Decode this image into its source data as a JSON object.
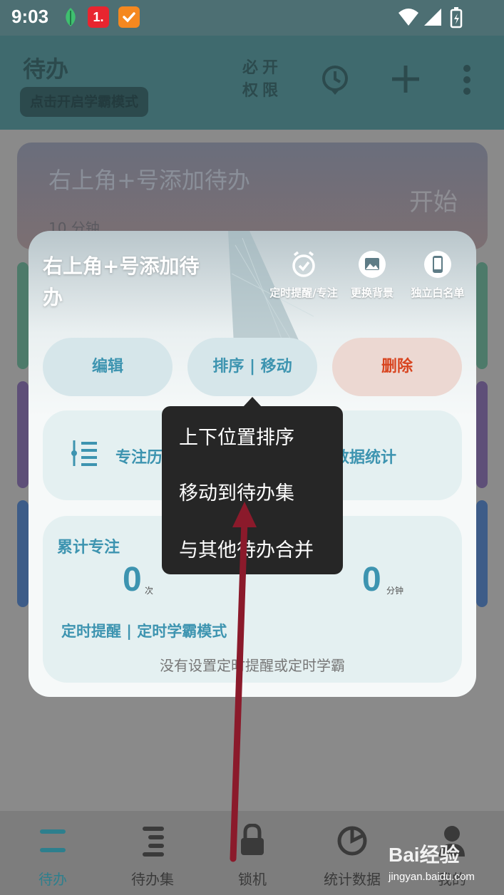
{
  "status_bar": {
    "time": "9:03",
    "app_badge": "1."
  },
  "header": {
    "title": "待办",
    "study_mode": "点击开启学霸模式",
    "permission": "必开权限"
  },
  "background_card": {
    "title": "右上角+号添加待办",
    "start": "开始",
    "duration": "10 分钟"
  },
  "popup": {
    "title": "右上角+号添加待办",
    "top_actions": [
      {
        "label": "定时提醒/专注",
        "icon": "alarm-clock-icon"
      },
      {
        "label": "更换背景",
        "icon": "image-icon"
      },
      {
        "label": "独立白名单",
        "icon": "phone-icon"
      }
    ],
    "buttons": {
      "edit": "编辑",
      "sort_move": "排序 | 移动",
      "delete": "删除"
    },
    "focus_history": "专注历",
    "data_stats": "数据统计",
    "accumulated": "累计专注",
    "count_value": "0",
    "count_unit": "次",
    "minutes_value": "0",
    "minutes_unit": "分钟",
    "timer_mode": "定时提醒 | 定时学霸模式",
    "no_timer": "没有设置定时提醒或定时学霸"
  },
  "menu": {
    "items": [
      "上下位置排序",
      "移动到待办集",
      "与其他待办合并"
    ]
  },
  "bottom_nav": {
    "items": [
      {
        "label": "待办",
        "icon": "todo-icon",
        "active": true
      },
      {
        "label": "待办集",
        "icon": "todo-set-icon",
        "active": false
      },
      {
        "label": "锁机",
        "icon": "lock-icon",
        "active": false
      },
      {
        "label": "统计数据",
        "icon": "pie-chart-icon",
        "active": false
      },
      {
        "label": "我的",
        "icon": "profile-icon",
        "active": false
      }
    ]
  },
  "watermark": {
    "brand": "Bai经验",
    "url": "jingyan.baidu.com"
  },
  "colors": {
    "accent": "#3d94b0",
    "delete": "#d8441f",
    "arrow": "#8b1a2b",
    "menu_bg": "#262626"
  }
}
